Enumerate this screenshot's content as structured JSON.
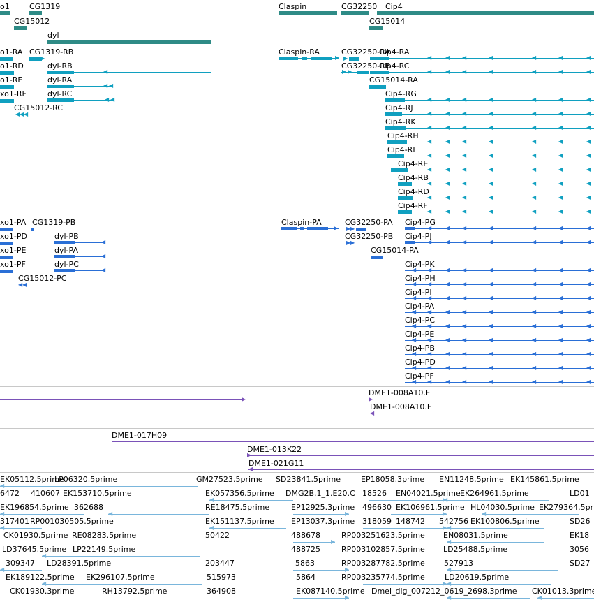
{
  "colors": {
    "gene": "#2e8b86",
    "transcript": "#10a0c0",
    "protein": "#2a6fd6",
    "clone": "#7a52b8",
    "est": "#7ab6dc",
    "separator": "#c8c8c8"
  },
  "tracks": [
    {
      "name": "genes",
      "color": "gene",
      "features": [
        {
          "label": "o1"
        },
        {
          "label": "CG1319"
        },
        {
          "label": "CG15012"
        },
        {
          "label": "dyl"
        },
        {
          "label": "Claspin"
        },
        {
          "label": "CG32250"
        },
        {
          "label": "Cip4"
        },
        {
          "label": "CG15014"
        }
      ]
    },
    {
      "name": "transcripts",
      "color": "transcript",
      "features": [
        {
          "label": "o1-RA"
        },
        {
          "label": "CG1319-RB"
        },
        {
          "label": "o1-RD"
        },
        {
          "label": "dyl-RB"
        },
        {
          "label": "o1-RE"
        },
        {
          "label": "dyl-RA"
        },
        {
          "label": "xo1-RF"
        },
        {
          "label": "dyl-RC"
        },
        {
          "label": "CG15012-RC"
        },
        {
          "label": "Claspin-RA"
        },
        {
          "label": "CG32250-RA"
        },
        {
          "label": "Cip4-RA"
        },
        {
          "label": "CG32250-RB"
        },
        {
          "label": "Cip4-RC"
        },
        {
          "label": "CG15014-RA"
        },
        {
          "label": "Cip4-RG"
        },
        {
          "label": "Cip4-RJ"
        },
        {
          "label": "Cip4-RK"
        },
        {
          "label": "Cip4-RH"
        },
        {
          "label": "Cip4-RI"
        },
        {
          "label": "Cip4-RE"
        },
        {
          "label": "Cip4-RB"
        },
        {
          "label": "Cip4-RD"
        },
        {
          "label": "Cip4-RF"
        }
      ]
    },
    {
      "name": "proteins",
      "color": "protein",
      "features": [
        {
          "label": "xo1-PA"
        },
        {
          "label": "CG1319-PB"
        },
        {
          "label": "xo1-PD"
        },
        {
          "label": "dyl-PB"
        },
        {
          "label": "xo1-PE"
        },
        {
          "label": "dyl-PA"
        },
        {
          "label": "xo1-PF"
        },
        {
          "label": "dyl-PC"
        },
        {
          "label": "CG15012-PC"
        },
        {
          "label": "Claspin-PA"
        },
        {
          "label": "CG32250-PA"
        },
        {
          "label": "Cip4-PG"
        },
        {
          "label": "CG32250-PB"
        },
        {
          "label": "Cip4-PJ"
        },
        {
          "label": "CG15014-PA"
        },
        {
          "label": "Cip4-PK"
        },
        {
          "label": "Cip4-PH"
        },
        {
          "label": "Cip4-PI"
        },
        {
          "label": "Cip4-PA"
        },
        {
          "label": "Cip4-PC"
        },
        {
          "label": "Cip4-PE"
        },
        {
          "label": "Cip4-PB"
        },
        {
          "label": "Cip4-PD"
        },
        {
          "label": "Cip4-PF"
        }
      ]
    },
    {
      "name": "clones-1",
      "color": "clone",
      "features": [
        {
          "label": ""
        },
        {
          "label": "DME1-008A10.F"
        },
        {
          "label": "DME1-008A10.F"
        }
      ]
    },
    {
      "name": "clones-2",
      "color": "clone",
      "features": [
        {
          "label": "DME1-017H09"
        },
        {
          "label": "DME1-013K22"
        },
        {
          "label": "DME1-021G11"
        }
      ]
    },
    {
      "name": "ests",
      "color": "est",
      "features": [
        {
          "label": "EK05112.5prime"
        },
        {
          "label": "LP06320.5prime"
        },
        {
          "label": "GM27523.5prime"
        },
        {
          "label": "SD23841.5prime"
        },
        {
          "label": "EP18058.3prime"
        },
        {
          "label": "EN11248.5prime"
        },
        {
          "label": "EK145861.5prime"
        },
        {
          "label": "6472"
        },
        {
          "label": "410607"
        },
        {
          "label": "EK153710.5prime"
        },
        {
          "label": "EK057356.5prime"
        },
        {
          "label": "DMG2B.1_1.E20.C"
        },
        {
          "label": "18526"
        },
        {
          "label": "EN04021.5prime"
        },
        {
          "label": "EK264961.5prime"
        },
        {
          "label": "LD01"
        },
        {
          "label": "EK196854.5prime"
        },
        {
          "label": "362688"
        },
        {
          "label": "RE18475.5prime"
        },
        {
          "label": "EP12925.3prime"
        },
        {
          "label": "496630"
        },
        {
          "label": "EK106961.5prime"
        },
        {
          "label": "HL04030.5prime"
        },
        {
          "label": "EK279364.5prime"
        },
        {
          "label": "317401"
        },
        {
          "label": "RP001030505.5prime"
        },
        {
          "label": "EK151137.5prime"
        },
        {
          "label": "EP13037.3prime"
        },
        {
          "label": "318059"
        },
        {
          "label": "148742"
        },
        {
          "label": "542756"
        },
        {
          "label": "EK100806.5prime"
        },
        {
          "label": "SD26"
        },
        {
          "label": "CK01930.5prime"
        },
        {
          "label": "RE08283.5prime"
        },
        {
          "label": "50422"
        },
        {
          "label": "488678"
        },
        {
          "label": "RP003251623.5prime"
        },
        {
          "label": "EN08031.5prime"
        },
        {
          "label": "EK18"
        },
        {
          "label": "LD37645.5prime"
        },
        {
          "label": "LP22149.5prime"
        },
        {
          "label": "488725"
        },
        {
          "label": "RP003102857.5prime"
        },
        {
          "label": "LD25488.5prime"
        },
        {
          "label": "3056"
        },
        {
          "label": "309347"
        },
        {
          "label": "LD28391.5prime"
        },
        {
          "label": "203447"
        },
        {
          "label": "5863"
        },
        {
          "label": "RP003287782.5prime"
        },
        {
          "label": "527913"
        },
        {
          "label": "SD27"
        },
        {
          "label": "EK189122.5prime"
        },
        {
          "label": "EK296107.5prime"
        },
        {
          "label": "515973"
        },
        {
          "label": "5864"
        },
        {
          "label": "RP003235774.5prime"
        },
        {
          "label": "LD20619.5prime"
        },
        {
          "label": "CK01930.3prime"
        },
        {
          "label": "RH13792.5prime"
        },
        {
          "label": "364908"
        },
        {
          "label": "EK087140.5prime"
        },
        {
          "label": "Dmel_dig_00721"
        },
        {
          "label": "2_0619_2698.3prime"
        },
        {
          "label": "CK01013.3prime"
        }
      ]
    }
  ]
}
